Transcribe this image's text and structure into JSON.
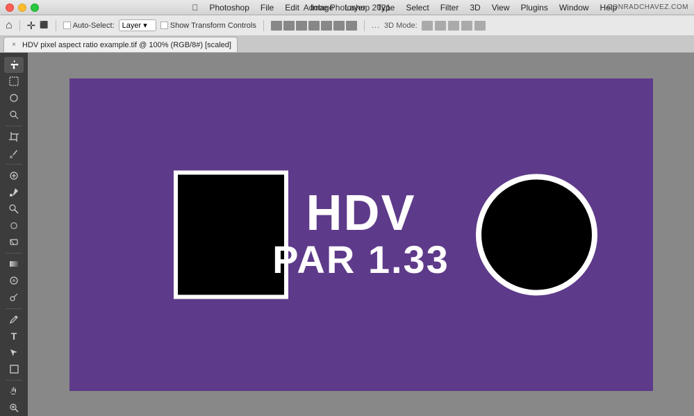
{
  "titlebar": {
    "title": "Adobe Photoshop 2021",
    "website": "CONRADCHAVEZ.COM"
  },
  "menubar": {
    "apple": "⌘",
    "app": "Photoshop",
    "items": [
      "File",
      "Edit",
      "Image",
      "Layer",
      "Type",
      "Select",
      "Filter",
      "3D",
      "View",
      "Plugins",
      "Window",
      "Help"
    ]
  },
  "optionsbar": {
    "auto_select_label": "Auto-Select:",
    "layer_dropdown": "Layer",
    "show_transform": "Show Transform Controls",
    "threed_mode": "3D Mode:",
    "more_dots": "...",
    "move_icon": "⊹"
  },
  "tab": {
    "close_symbol": "×",
    "title": "HDV pixel aspect ratio example.tif @ 100% (RGB/8#) [scaled]"
  },
  "canvas": {
    "background_color": "#5e3a8a",
    "text_line1": "HDV",
    "text_line2": "PAR 1.33",
    "text_color": "#ffffff"
  },
  "toolbar": {
    "tools": [
      {
        "name": "move",
        "icon": "✛"
      },
      {
        "name": "marquee",
        "icon": "⬚"
      },
      {
        "name": "lasso",
        "icon": "⌾"
      },
      {
        "name": "quick-select",
        "icon": "⊛"
      },
      {
        "name": "crop",
        "icon": "⊟"
      },
      {
        "name": "eyedropper",
        "icon": "⊘"
      },
      {
        "name": "healing",
        "icon": "✚"
      },
      {
        "name": "brush",
        "icon": "⊒"
      },
      {
        "name": "clone",
        "icon": "◫"
      },
      {
        "name": "history",
        "icon": "⊔"
      },
      {
        "name": "eraser",
        "icon": "◻"
      },
      {
        "name": "gradient",
        "icon": "⊡"
      },
      {
        "name": "blur",
        "icon": "⊙"
      },
      {
        "name": "dodge",
        "icon": "⊕"
      },
      {
        "name": "pen",
        "icon": "⊗"
      },
      {
        "name": "type",
        "icon": "T"
      },
      {
        "name": "path-select",
        "icon": "↖"
      },
      {
        "name": "shape",
        "icon": "□"
      },
      {
        "name": "hand",
        "icon": "☜"
      },
      {
        "name": "zoom",
        "icon": "⊕"
      }
    ]
  }
}
